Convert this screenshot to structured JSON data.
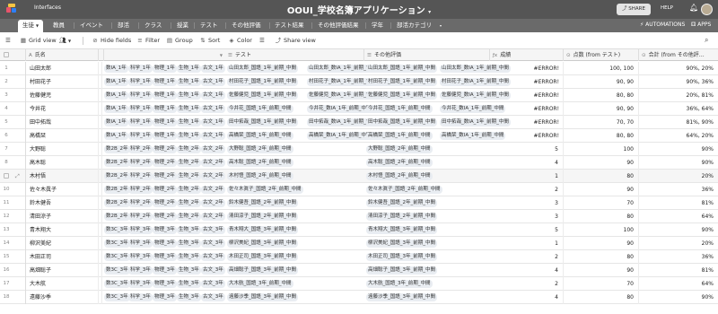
{
  "topbar": {
    "interfaces_label": "Interfaces",
    "title": "OOUI_学校名簿アプリケーション",
    "title_caret": "▾",
    "share_label": "SHARE",
    "help_label": "HELP",
    "bell_icon": "bell-icon"
  },
  "tabs": [
    {
      "label": "生徒",
      "active": true
    },
    {
      "label": "教員"
    },
    {
      "label": "イベント"
    },
    {
      "label": "部活"
    },
    {
      "label": "クラス"
    },
    {
      "label": "授業"
    },
    {
      "label": "テスト"
    },
    {
      "label": "その他評価"
    },
    {
      "label": "テスト結果"
    },
    {
      "label": "その他評価結果"
    },
    {
      "label": "学年"
    },
    {
      "label": "部活カテゴリ"
    }
  ],
  "tabs_more": "▾",
  "automations_label": "AUTOMATIONS",
  "apps_label": "APPS",
  "toolbar": {
    "grid_view": "Grid view",
    "hide_fields": "Hide fields",
    "filter": "Filter",
    "group": "Group",
    "sort": "Sort",
    "color": "Color",
    "share_view": "Share view"
  },
  "columns": {
    "name": "氏名",
    "test": "テスト",
    "other": "その他評価",
    "grade": "成績",
    "score": "点数 (from テスト)",
    "total": "合計 (from その他評…"
  },
  "rows": [
    {
      "n": "1",
      "name": "山田太郎",
      "chips": [
        "数IA_1年",
        "科学_1年",
        "物理_1年",
        "生物_1年",
        "古文_1年",
        "山田太郎_国語_1年_前期_中間",
        "山田太郎_数IA_1年_前期_中間",
        "山田太郎_国語_1年_前期_中間",
        "山田太郎_数IA_1年_前期_中間"
      ],
      "grade": "#ERROR!",
      "score": "100, 100",
      "total": "90%, 20%"
    },
    {
      "n": "2",
      "name": "村田花子",
      "chips": [
        "数IA_1年",
        "科学_1年",
        "物理_1年",
        "生物_1年",
        "古文_1年",
        "村田花子_国語_1年_前期_中間",
        "村田花子_数IA_1年_前期_中間",
        "村田花子_国語_1年_前期_中間",
        "村田花子_数IA_1年_前期_中間"
      ],
      "grade": "#ERROR!",
      "score": "90, 90",
      "total": "90%, 36%"
    },
    {
      "n": "3",
      "name": "佐藤健児",
      "chips": [
        "数IA_1年",
        "科学_1年",
        "物理_1年",
        "生物_1年",
        "古文_1年",
        "佐藤健児_国語_1年_前期_中間",
        "佐藤健児_数IA_1年_前期_中間",
        "佐藤健児_国語_1年_前期_中間",
        "佐藤健児_数IA_1年_前期_中間"
      ],
      "grade": "#ERROR!",
      "score": "80, 80",
      "total": "20%, 81%"
    },
    {
      "n": "4",
      "name": "今井花",
      "chips": [
        "数IA_1年",
        "科学_1年",
        "物理_1年",
        "生物_1年",
        "古文_1年",
        "今井花_国語_1年_前期_中間",
        "今井花_数IA_1年_前期_中間",
        "今井花_国語_1年_前期_中間",
        "今井花_数IA_1年_前期_中間"
      ],
      "grade": "#ERROR!",
      "score": "90, 90",
      "total": "36%, 64%"
    },
    {
      "n": "5",
      "name": "田中拓哉",
      "chips": [
        "数IA_1年",
        "科学_1年",
        "物理_1年",
        "生物_1年",
        "古文_1年",
        "田中拓哉_国語_1年_前期_中間",
        "田中拓哉_数IA_1年_前期_中間",
        "田中拓哉_国語_1年_前期_中間",
        "田中拓哉_数IA_1年_前期_中間"
      ],
      "grade": "#ERROR!",
      "score": "70, 70",
      "total": "81%, 90%"
    },
    {
      "n": "6",
      "name": "高橋栞",
      "chips": [
        "数IA_1年",
        "科学_1年",
        "物理_1年",
        "生物_1年",
        "古文_1年",
        "高橋栞_国語_1年_前期_中間",
        "高橋栞_数IA_1年_前期_中間",
        "高橋栞_国語_1年_前期_中間",
        "高橋栞_数IA_1年_前期_中間"
      ],
      "grade": "#ERROR!",
      "score": "80, 80",
      "total": "64%, 20%"
    },
    {
      "n": "7",
      "name": "大野聡",
      "chips": [
        "数2B_2年",
        "科学_2年",
        "物理_2年",
        "生物_2年",
        "古文_2年",
        "大野聡_国語_2年_前期_中間",
        "大野聡_国語_2年_前期_中間"
      ],
      "grade": "5",
      "score": "100",
      "total": "90%"
    },
    {
      "n": "8",
      "name": "高木聡",
      "chips": [
        "数2B_2年",
        "科学_2年",
        "物理_2年",
        "生物_2年",
        "古文_2年",
        "高木聡_国語_2年_前期_中間",
        "高木聡_国語_2年_前期_中間"
      ],
      "grade": "4",
      "score": "90",
      "total": "90%"
    },
    {
      "n": "9",
      "name": "木村悟",
      "chips": [
        "数2B_2年",
        "科学_2年",
        "物理_2年",
        "生物_2年",
        "古文_2年",
        "木村悟_国語_2年_前期_中間",
        "木村悟_国語_2年_前期_中間"
      ],
      "grade": "1",
      "score": "80",
      "total": "20%"
    },
    {
      "n": "10",
      "name": "佐々木眞子",
      "chips": [
        "数2B_2年",
        "科学_2年",
        "物理_2年",
        "生物_2年",
        "古文_2年",
        "佐々木眞子_国語_2年_前期_中間",
        "佐々木眞子_国語_2年_前期_中間"
      ],
      "grade": "2",
      "score": "90",
      "total": "36%"
    },
    {
      "n": "11",
      "name": "鈴木健吾",
      "chips": [
        "数2B_2年",
        "科学_2年",
        "物理_2年",
        "生物_2年",
        "古文_2年",
        "鈴木健吾_国語_2年_前期_中間",
        "鈴木健吾_国語_2年_前期_中間"
      ],
      "grade": "3",
      "score": "70",
      "total": "81%"
    },
    {
      "n": "12",
      "name": "清田涼子",
      "chips": [
        "数2B_2年",
        "科学_2年",
        "物理_2年",
        "生物_2年",
        "古文_2年",
        "清田涼子_国語_2年_前期_中間",
        "清田涼子_国語_2年_前期_中間"
      ],
      "grade": "3",
      "score": "80",
      "total": "64%"
    },
    {
      "n": "13",
      "name": "青木翔大",
      "chips": [
        "数3C_3年",
        "科学_3年",
        "物理_3年",
        "生物_3年",
        "古文_3年",
        "青木翔大_国語_3年_前期_中間",
        "青木翔大_国語_3年_前期_中間"
      ],
      "grade": "5",
      "score": "100",
      "total": "90%"
    },
    {
      "n": "14",
      "name": "柳沢美紀",
      "chips": [
        "数3C_3年",
        "科学_3年",
        "物理_3年",
        "生物_3年",
        "古文_3年",
        "柳沢美紀_国語_3年_前期_中間",
        "柳沢美紀_国語_3年_前期_中間"
      ],
      "grade": "1",
      "score": "90",
      "total": "20%"
    },
    {
      "n": "15",
      "name": "木田正司",
      "chips": [
        "数3C_3年",
        "科学_3年",
        "物理_3年",
        "生物_3年",
        "古文_3年",
        "木田正司_国語_3年_前期_中間",
        "木田正司_国語_3年_前期_中間"
      ],
      "grade": "2",
      "score": "80",
      "total": "36%"
    },
    {
      "n": "16",
      "name": "高畑聡子",
      "chips": [
        "数3C_3年",
        "科学_3年",
        "物理_3年",
        "生物_3年",
        "古文_3年",
        "高畑聡子_国語_3年_前期_中間",
        "高畑聡子_国語_3年_前期_中間"
      ],
      "grade": "4",
      "score": "90",
      "total": "81%"
    },
    {
      "n": "17",
      "name": "大木航",
      "chips": [
        "数3C_3年",
        "科学_3年",
        "物理_3年",
        "生物_3年",
        "古文_3年",
        "大木航_国語_3年_前期_中間",
        "大木航_国語_3年_前期_中間"
      ],
      "grade": "2",
      "score": "70",
      "total": "64%"
    },
    {
      "n": "18",
      "name": "遠藤沙季",
      "chips": [
        "数3C_3年",
        "科学_3年",
        "物理_3年",
        "生物_3年",
        "古文_3年",
        "遠藤沙季_国語_3年_前期_中間",
        "遠藤沙季_国語_3年_前期_中間"
      ],
      "grade": "4",
      "score": "80",
      "total": "90%"
    }
  ],
  "colors": {
    "topbar": "#555555",
    "tabsbar": "#6a6a6a",
    "chip_bg": "#e9edf2",
    "logo": [
      "#f5c542",
      "#e8546b",
      "#2d7ff9"
    ]
  }
}
